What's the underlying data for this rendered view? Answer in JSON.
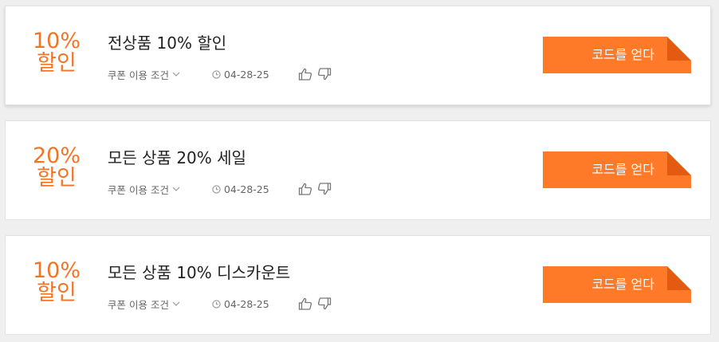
{
  "coupons": [
    {
      "discount_value": "10%",
      "discount_unit": "할인",
      "title": "전상품 10% 할인",
      "conditions_label": "쿠폰 이용 조건",
      "expiry": "04-28-25",
      "button_label": "코드를 얻다"
    },
    {
      "discount_value": "20%",
      "discount_unit": "할인",
      "title": "모든 상품 20% 세일",
      "conditions_label": "쿠폰 이용 조건",
      "expiry": "04-28-25",
      "button_label": "코드를 얻다"
    },
    {
      "discount_value": "10%",
      "discount_unit": "할인",
      "title": "모든 상품 10% 디스카운트",
      "conditions_label": "쿠폰 이용 조건",
      "expiry": "04-28-25",
      "button_label": "코드를 얻다"
    }
  ],
  "icons": {
    "conditions_toggle": "chevron-down-icon",
    "expiry": "clock-icon",
    "vote_up": "thumbs-up-icon",
    "vote_down": "thumbs-down-icon"
  },
  "colors": {
    "accent": "#f27526",
    "button": "#ff7a28",
    "button_fold": "#e35a10"
  }
}
